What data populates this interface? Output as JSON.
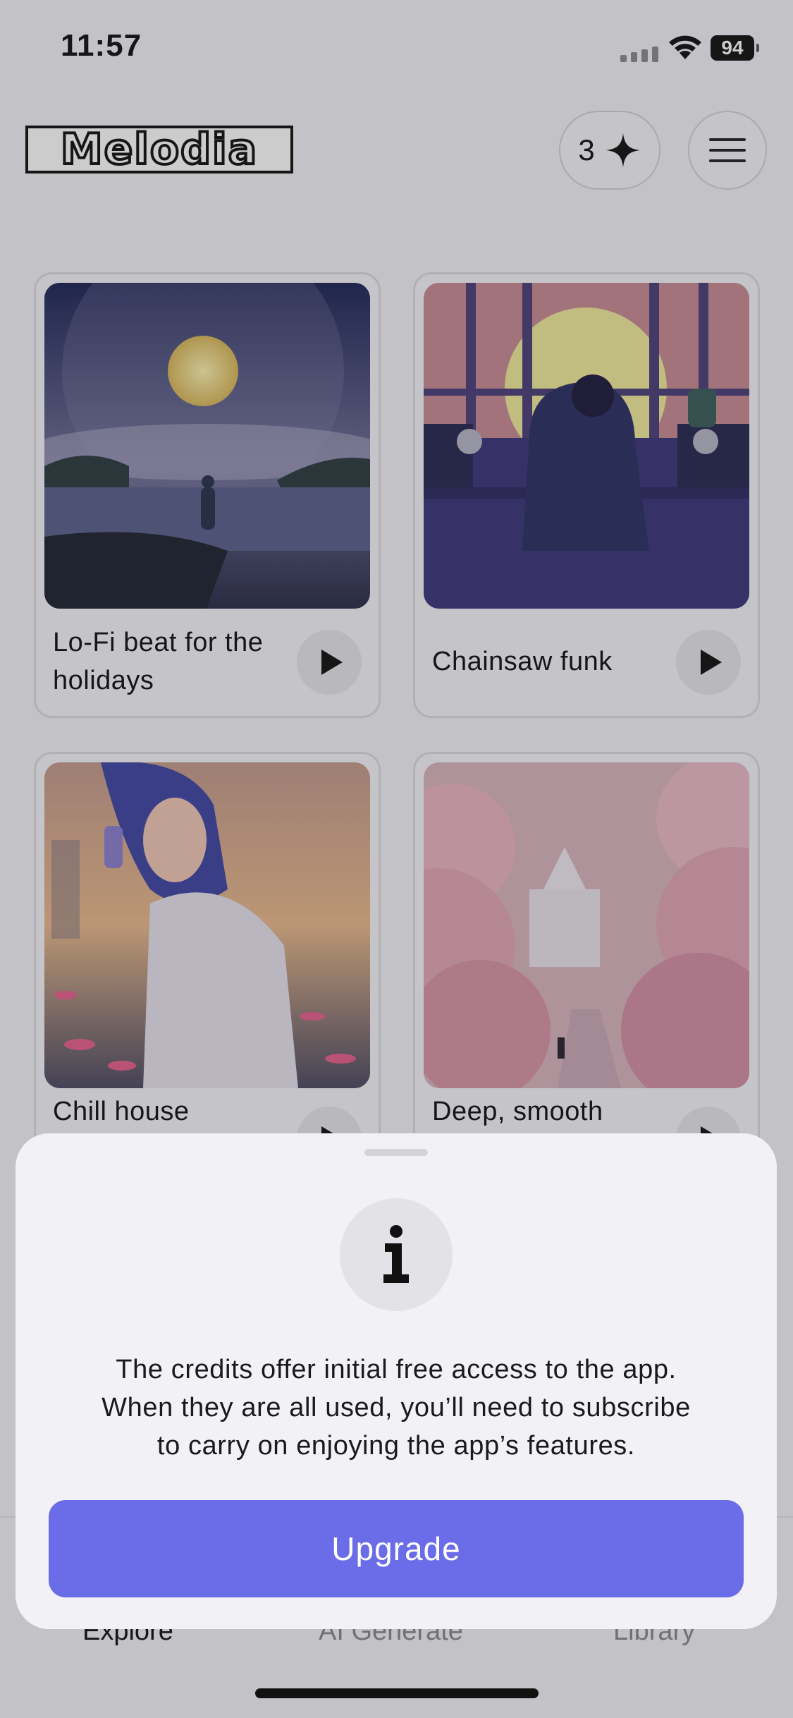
{
  "status_bar": {
    "time": "11:57",
    "battery": "94"
  },
  "header": {
    "logo_text": "Melodia",
    "credits_count": "3"
  },
  "cards": [
    {
      "title": "Lo-Fi beat for the holidays"
    },
    {
      "title": "Chainsaw funk"
    },
    {
      "title": "Chill house"
    },
    {
      "title": "Deep, smooth"
    }
  ],
  "tabs": [
    {
      "label": "Explore",
      "active": true
    },
    {
      "label": "AI Generate",
      "active": false
    },
    {
      "label": "Library",
      "active": false
    }
  ],
  "sheet": {
    "message_lines": [
      "The credits offer initial free access to the app.",
      "When they are all used, you’ll need to subscribe",
      "to carry on enjoying the app’s features."
    ],
    "button_label": "Upgrade"
  },
  "colors": {
    "accent": "#6b6ce8",
    "sheet_bg": "#f2f1f6"
  },
  "icons": [
    "sparkle-icon",
    "menu-icon",
    "play-icon",
    "info-icon",
    "wifi-icon"
  ]
}
